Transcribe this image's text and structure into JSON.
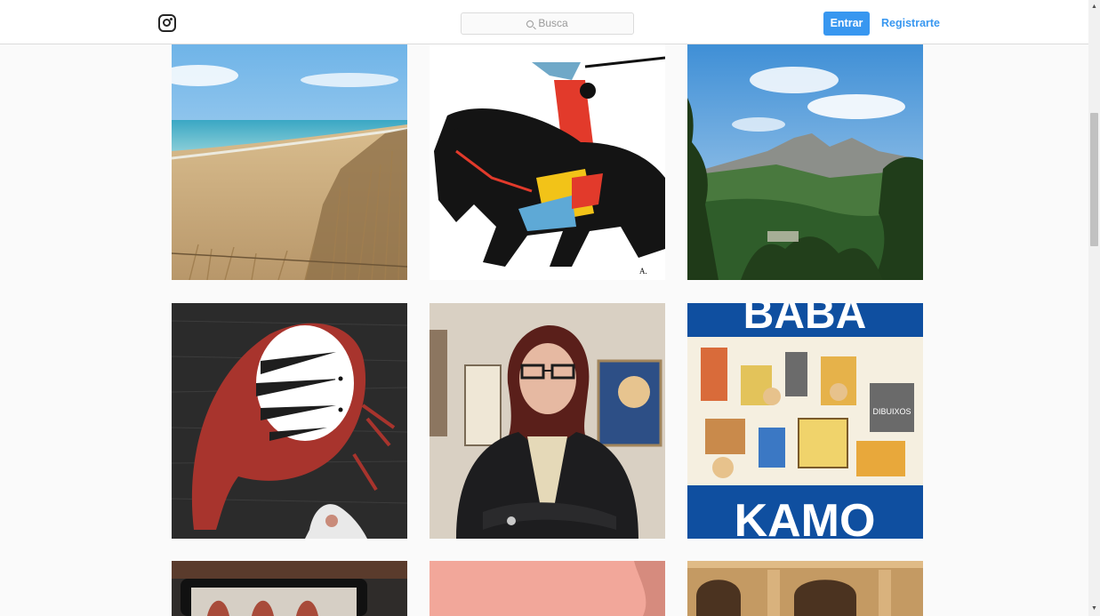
{
  "header": {
    "logo_icon": "instagram-camera-icon",
    "search_placeholder": "Busca",
    "login_label": "Entrar",
    "signup_label": "Registrarte"
  },
  "colors": {
    "accent": "#3897f0",
    "header_bg": "#ffffff",
    "page_bg": "#fafafa",
    "border": "#dbdbdb"
  },
  "grid": {
    "posts": [
      {
        "depicts": "beach-dunes-photo"
      },
      {
        "depicts": "horseman-illustration"
      },
      {
        "depicts": "mountain-landscape-photo"
      },
      {
        "depicts": "red-monster-illustration"
      },
      {
        "depicts": "woman-portrait-photo"
      },
      {
        "depicts": "baba-kamo-poster",
        "text_top": "BABA",
        "text_bottom": "KAMO",
        "text_inner": "DIBUIXOS"
      },
      {
        "depicts": "tablet-photo"
      },
      {
        "depicts": "pink-wall-photo"
      },
      {
        "depicts": "stone-arches-photo"
      }
    ]
  }
}
